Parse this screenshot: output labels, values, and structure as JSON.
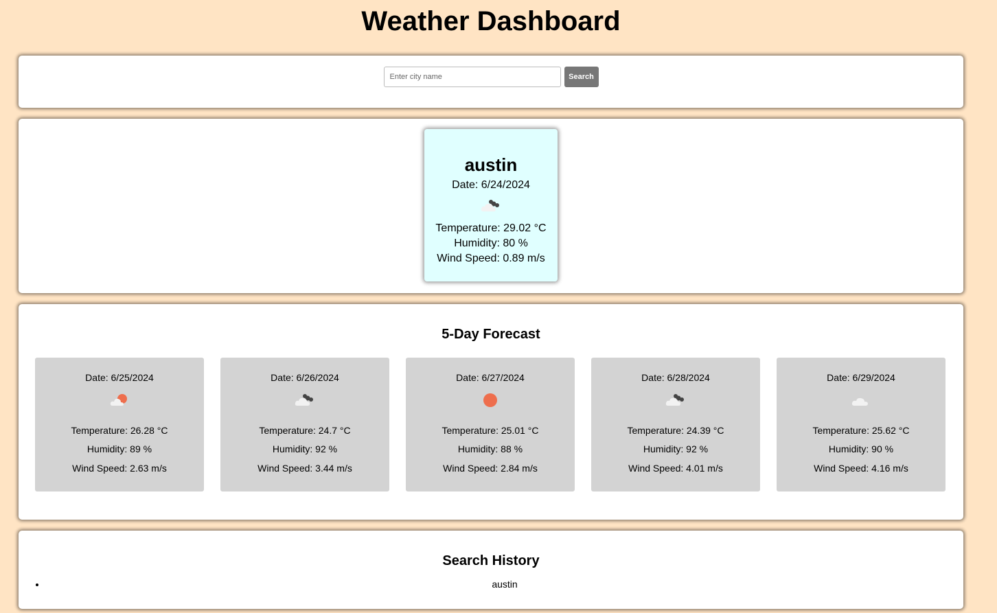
{
  "page": {
    "title": "Weather Dashboard"
  },
  "search": {
    "placeholder": "Enter city name",
    "value": "",
    "button_label": "Search"
  },
  "current": {
    "city": "austin",
    "date": "Date: 6/24/2024",
    "icon": "broken-clouds-icon",
    "temperature": "Temperature: 29.02 °C",
    "humidity": "Humidity: 80 %",
    "wind": "Wind Speed: 0.89 m/s"
  },
  "forecast": {
    "title": "5-Day Forecast",
    "days": [
      {
        "date": "Date: 6/25/2024",
        "icon": "few-clouds-icon",
        "temperature": "Temperature: 26.28 °C",
        "humidity": "Humidity: 89 %",
        "wind": "Wind Speed: 2.63 m/s"
      },
      {
        "date": "Date: 6/26/2024",
        "icon": "broken-clouds-icon",
        "temperature": "Temperature: 24.7 °C",
        "humidity": "Humidity: 92 %",
        "wind": "Wind Speed: 3.44 m/s"
      },
      {
        "date": "Date: 6/27/2024",
        "icon": "clear-sky-icon",
        "temperature": "Temperature: 25.01 °C",
        "humidity": "Humidity: 88 %",
        "wind": "Wind Speed: 2.84 m/s"
      },
      {
        "date": "Date: 6/28/2024",
        "icon": "broken-clouds-icon",
        "temperature": "Temperature: 24.39 °C",
        "humidity": "Humidity: 92 %",
        "wind": "Wind Speed: 4.01 m/s"
      },
      {
        "date": "Date: 6/29/2024",
        "icon": "scattered-clouds-icon",
        "temperature": "Temperature: 25.62 °C",
        "humidity": "Humidity: 90 %",
        "wind": "Wind Speed: 4.16 m/s"
      }
    ]
  },
  "history": {
    "title": "Search History",
    "items": [
      "austin"
    ]
  },
  "colors": {
    "background": "#ffe4c4",
    "current_card": "#e0ffff",
    "forecast_card": "#d3d3d3",
    "button": "#777777",
    "sun": "#ee6e4d"
  }
}
